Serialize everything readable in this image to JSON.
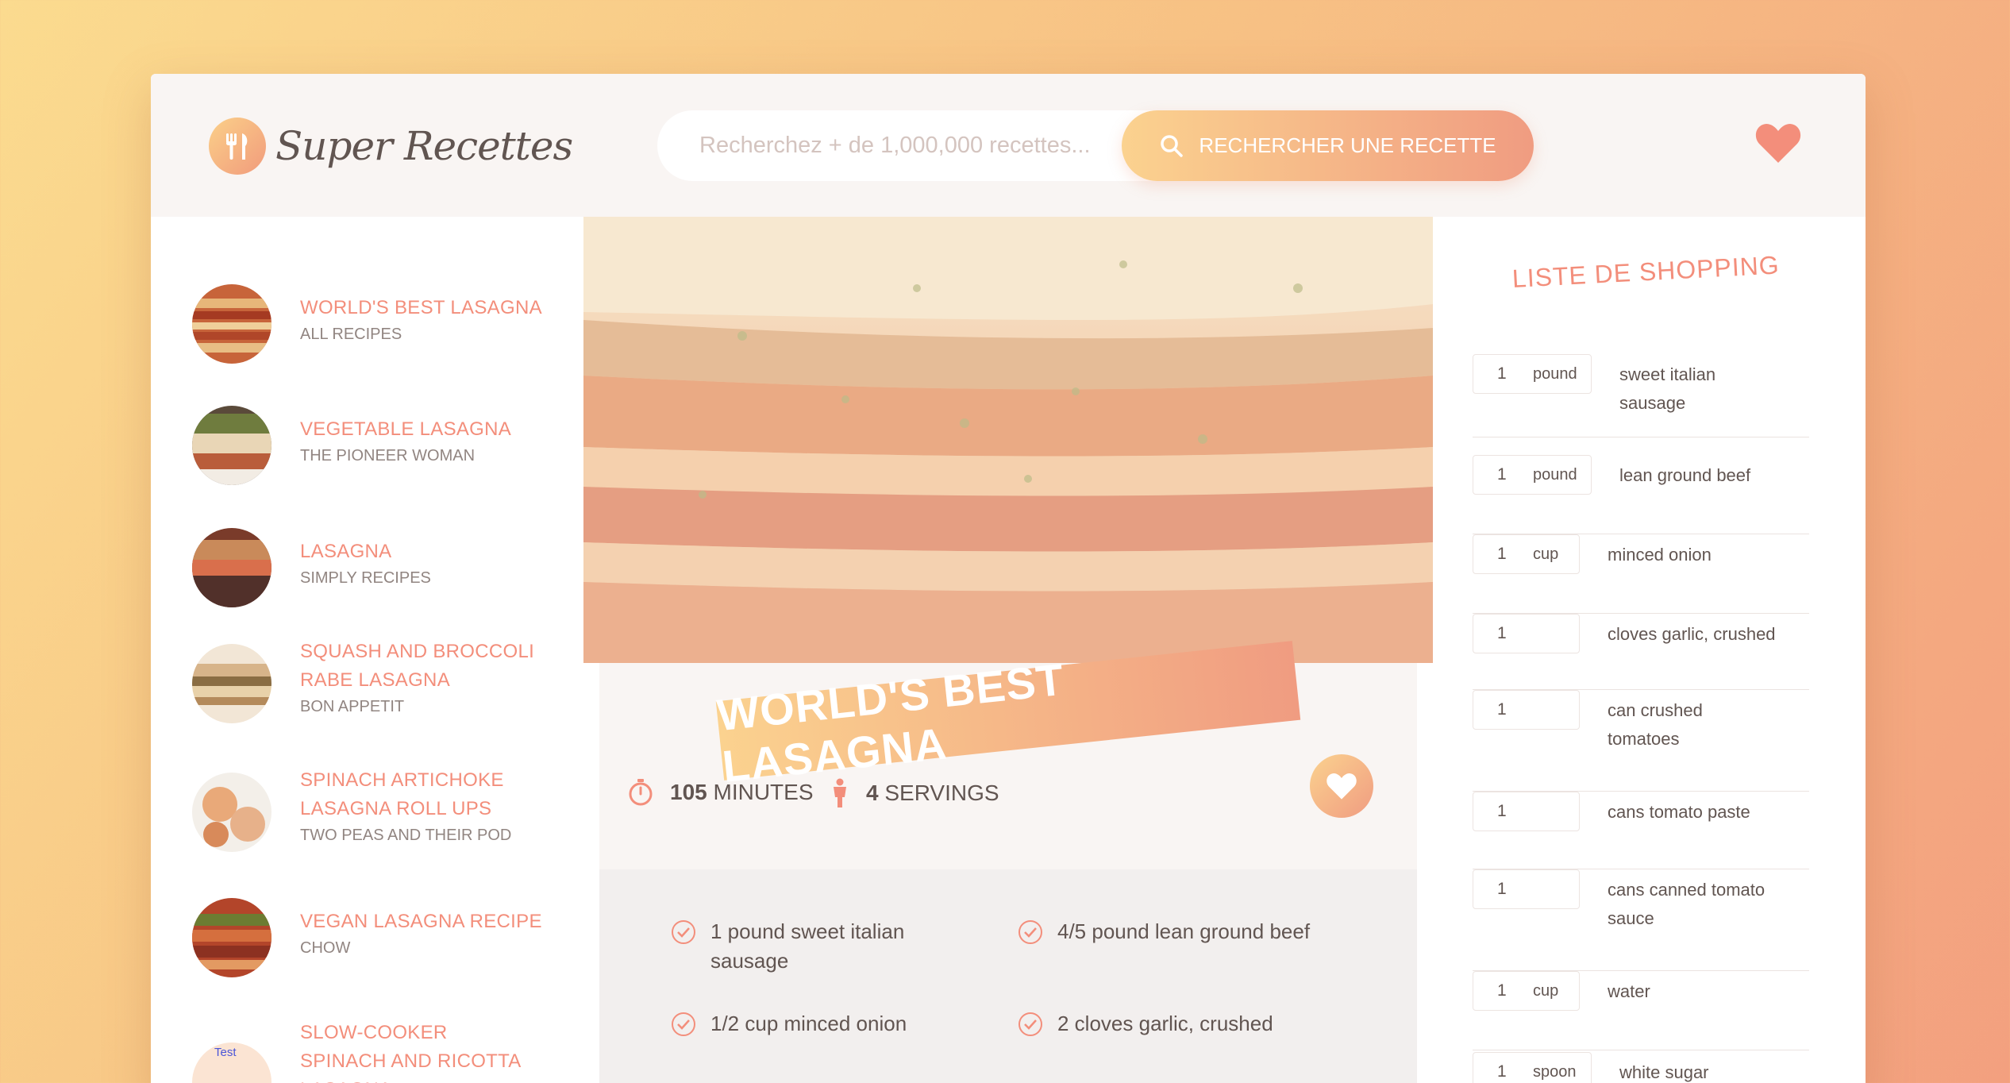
{
  "app": {
    "logo_text": "Super Recettes",
    "logo_icon": "fork-knife-icon"
  },
  "search": {
    "placeholder": "Recherchez + de 1,000,000 recettes...",
    "button_label": "RECHERCHER UNE RECETTE",
    "button_icon": "search-icon"
  },
  "header": {
    "bookmarks_icon": "heart-icon"
  },
  "results": [
    {
      "title": "WORLD'S BEST LASAGNA",
      "author": "ALL RECIPES"
    },
    {
      "title": "VEGETABLE LASAGNA",
      "author": "THE PIONEER WOMAN"
    },
    {
      "title": "LASAGNA",
      "author": "SIMPLY RECIPES"
    },
    {
      "title": "SQUASH AND BROCCOLI RABE LASAGNA",
      "author": "BON APPETIT"
    },
    {
      "title": "SPINACH ARTICHOKE LASAGNA ROLL UPS",
      "author": "TWO PEAS AND THEIR POD"
    },
    {
      "title": "VEGAN LASAGNA RECIPE",
      "author": "CHOW"
    },
    {
      "title": "SLOW-COOKER SPINACH AND RICOTTA LASAGNA",
      "author": "",
      "image_alt": "Test"
    }
  ],
  "recipe": {
    "title": "WORLD'S BEST LASAGNA",
    "minutes_value": "105",
    "minutes_label": "MINUTES",
    "servings_value": "4",
    "servings_label": "SERVINGS",
    "ingredients": [
      "1 pound sweet italian sausage",
      "4/5 pound lean ground beef",
      "1/2 cup minced onion",
      "2 cloves garlic, crushed"
    ]
  },
  "shopping": {
    "title": "LISTE DE SHOPPING",
    "items": [
      {
        "qty": "1",
        "unit": "pound",
        "desc": "sweet italian sausage"
      },
      {
        "qty": "1",
        "unit": "pound",
        "desc": "lean ground beef"
      },
      {
        "qty": "1",
        "unit": "cup",
        "desc": "minced onion"
      },
      {
        "qty": "1",
        "unit": "",
        "desc": "cloves garlic, crushed"
      },
      {
        "qty": "1",
        "unit": "",
        "desc": "can crushed tomatoes"
      },
      {
        "qty": "1",
        "unit": "",
        "desc": "cans tomato paste"
      },
      {
        "qty": "1",
        "unit": "",
        "desc": "cans canned tomato sauce"
      },
      {
        "qty": "1",
        "unit": "cup",
        "desc": "water"
      },
      {
        "qty": "1",
        "unit": "spoon",
        "desc": "white sugar"
      }
    ]
  },
  "colors": {
    "accent": "#f38e7b",
    "gradient_start": "#fbd28f",
    "gradient_end": "#f09c81",
    "text": "#615551"
  }
}
